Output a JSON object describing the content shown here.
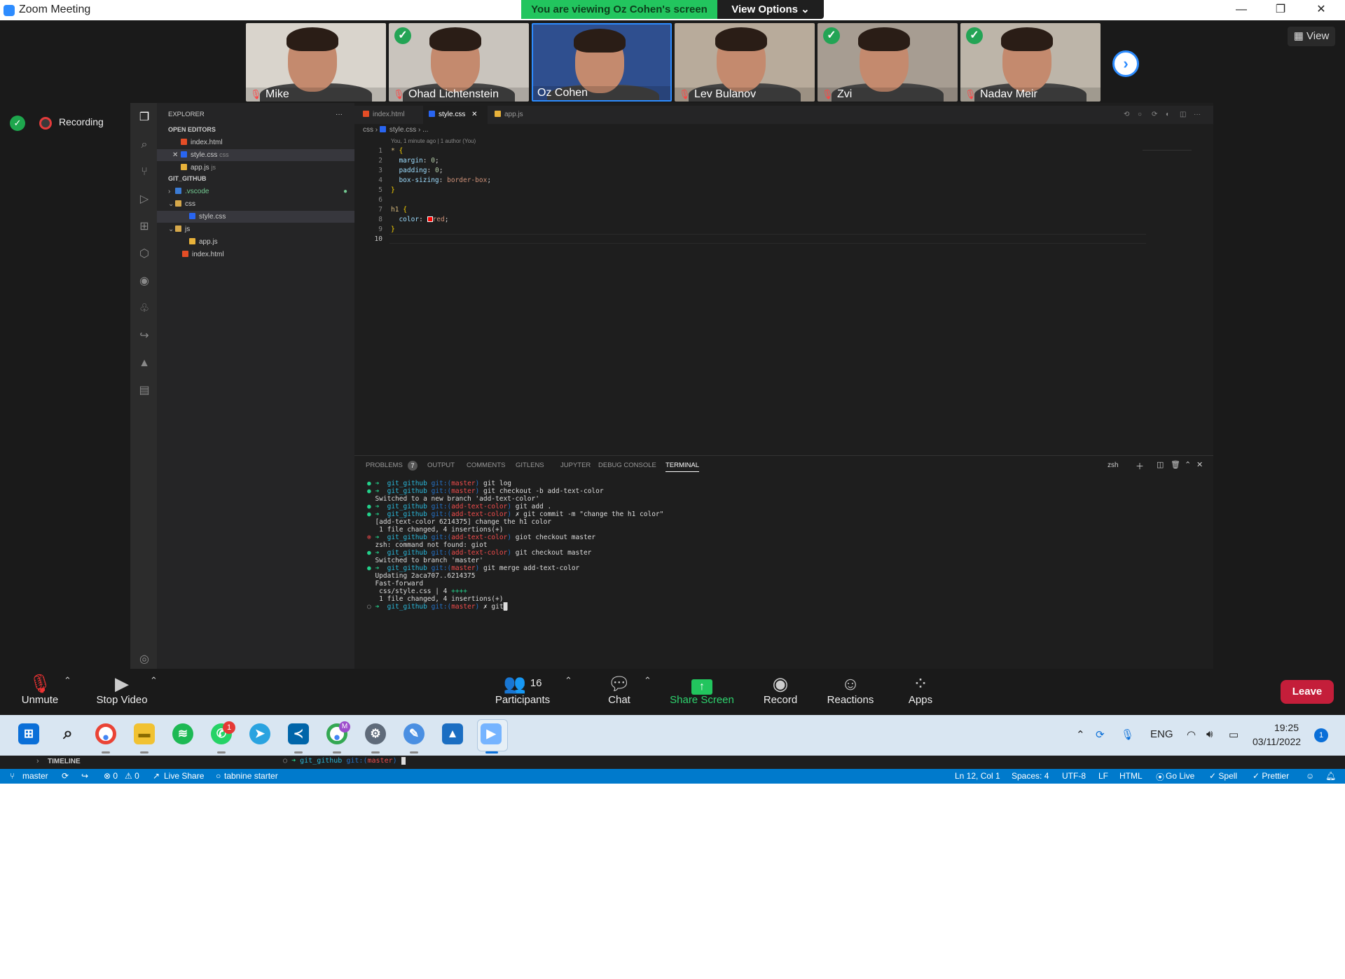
{
  "window": {
    "title": "Zoom Meeting",
    "minimize": "—",
    "restore": "❐",
    "close": "✕"
  },
  "banner": {
    "viewing": "You are viewing Oz Cohen's screen",
    "view_options": "View Options ⌄"
  },
  "participants_strip": [
    {
      "name": "Mike",
      "muted": true,
      "verified": false,
      "active": false,
      "bg": "#d9d4cc"
    },
    {
      "name": "Ohad Lichtenstein",
      "muted": true,
      "verified": true,
      "active": false,
      "bg": "#c9c4bd"
    },
    {
      "name": "Oz Cohen",
      "muted": false,
      "verified": false,
      "active": true,
      "bg": "#2f4f8f"
    },
    {
      "name": "Lev Bulanov",
      "muted": true,
      "verified": false,
      "active": false,
      "bg": "#b8ab9b"
    },
    {
      "name": "Zvi",
      "muted": true,
      "verified": true,
      "active": false,
      "bg": "#a79d92"
    },
    {
      "name": "Nadav Meir",
      "muted": true,
      "verified": true,
      "active": false,
      "bg": "#bdb5a9"
    }
  ],
  "view_button": "▦ View",
  "next_arrow": "›",
  "recording": {
    "label": "Recording",
    "shield": "✓"
  },
  "vscode": {
    "explorer_title": "EXPLORER",
    "more": "···",
    "open_editors_title": "OPEN EDITORS",
    "open_editors": [
      {
        "name": "index.html",
        "hint": "",
        "type": "html"
      },
      {
        "name": "style.css",
        "hint": "css",
        "type": "css"
      },
      {
        "name": "app.js",
        "hint": "js",
        "type": "js"
      }
    ],
    "workspace_title": "GIT_GITHUB",
    "tree": [
      {
        "name": ".vscode",
        "type": "vsc",
        "arrow": "›"
      },
      {
        "name": "css",
        "type": "dir",
        "arrow": "⌄"
      },
      {
        "name": "style.css",
        "type": "css",
        "arrow": ""
      },
      {
        "name": "js",
        "type": "dir",
        "arrow": "⌄"
      },
      {
        "name": "app.js",
        "type": "js",
        "arrow": ""
      },
      {
        "name": "index.html",
        "type": "html",
        "arrow": ""
      }
    ],
    "tabs": [
      {
        "name": "index.html",
        "type": "html"
      },
      {
        "name": "style.css",
        "type": "css"
      },
      {
        "name": "app.js",
        "type": "js"
      }
    ],
    "breadcrumb": {
      "folder": "css",
      "file": "style.css",
      "tail": "..."
    },
    "blame": "You, 1 minute ago | 1 author (You)",
    "line_numbers": [
      "1",
      "2",
      "3",
      "4",
      "5",
      "6",
      "7",
      "8",
      "9",
      "10"
    ],
    "panel_tabs": [
      "PROBLEMS",
      "OUTPUT",
      "COMMENTS",
      "GITLENS",
      "JUPYTER",
      "DEBUG CONSOLE",
      "TERMINAL"
    ],
    "problems_count": "7",
    "shell": "zsh",
    "timeline_label": "TIMELINE",
    "timeline_prompt": {
      "dir": "git_github",
      "git": "git:(",
      "branch": "master",
      "close": ")"
    }
  },
  "controls": {
    "unmute": "Unmute",
    "stop_video": "Stop Video",
    "participants": "Participants",
    "participants_count": "16",
    "chat": "Chat",
    "share_screen": "Share Screen",
    "record": "Record",
    "reactions": "Reactions",
    "apps": "Apps",
    "leave": "Leave"
  },
  "taskbar": {
    "whatsapp_badge": "1",
    "chrome_profile": "M",
    "language": "ENG",
    "time": "19:25",
    "date": "03/11/2022",
    "notifications": "1"
  },
  "statusbar": {
    "branch": "master",
    "errors": "⊗ 0",
    "warnings": "⚠ 0",
    "live_share": "Live Share",
    "tabnine": "tabnine starter",
    "position": "Ln 12, Col 1",
    "spaces": "Spaces: 4",
    "encoding": "UTF-8",
    "eol": "LF",
    "language": "HTML",
    "go_live": "Go Live",
    "spell": "✓ Spell",
    "prettier": "✓ Prettier"
  },
  "colors": {
    "zoom_blue": "#2d8cff",
    "banner_green": "#22c55e",
    "leave_red": "#c41e3a",
    "vscode_blue": "#007acc"
  }
}
